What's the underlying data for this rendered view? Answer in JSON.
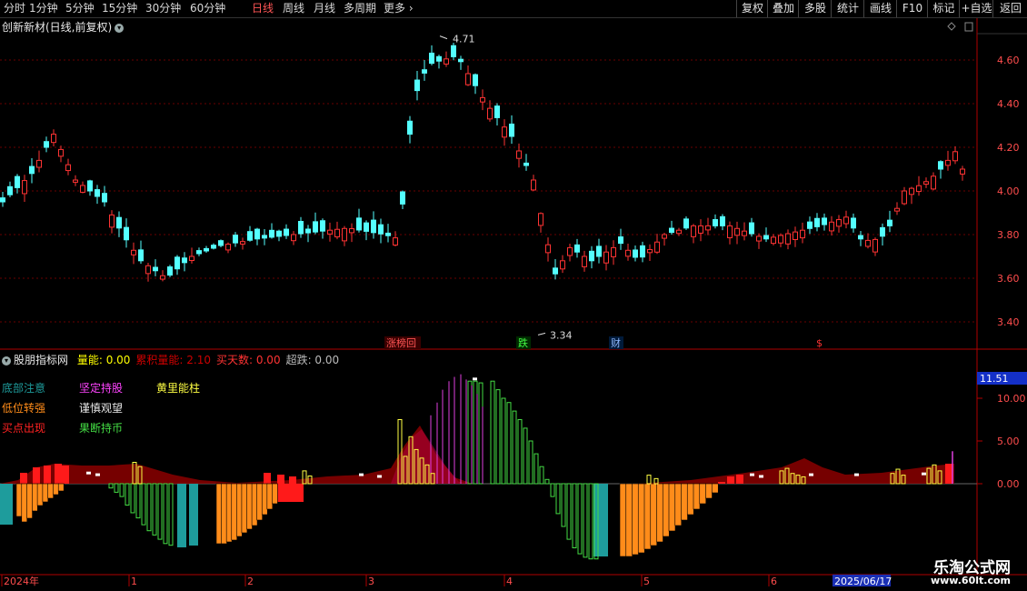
{
  "toolbar": {
    "periods": [
      "分时",
      "1分钟",
      "5分钟",
      "15分钟",
      "30分钟",
      "60分钟",
      "日线",
      "周线",
      "月线",
      "多周期",
      "更多"
    ],
    "active_period": "日线",
    "right_buttons": [
      "复权",
      "叠加",
      "多股",
      "统计",
      "画线",
      "F10",
      "标记",
      "+自选",
      "返回"
    ]
  },
  "price_panel": {
    "stock_title": "创新新材(日线,前复权)",
    "y_ticks": [
      "4.60",
      "4.40",
      "4.20",
      "4.00",
      "3.80",
      "3.60",
      "3.40"
    ],
    "high_label": "4.71",
    "low_label": "3.34",
    "event_labels": [
      "涨榜回",
      "跌",
      "财",
      "$"
    ]
  },
  "indicator_panel": {
    "name": "股朋指标网",
    "fields": [
      {
        "label": "量能:",
        "value": "0.00",
        "color": "#ffff00"
      },
      {
        "label": "累积量能:",
        "value": "2.10",
        "color": "#cc0000"
      },
      {
        "label": "买天数:",
        "value": "0.00",
        "color": "#ff3333"
      },
      {
        "label": "超跌:",
        "value": "0.00",
        "color": "#bbbbbb"
      }
    ],
    "legend": [
      {
        "text": "底部注意",
        "color": "#1e9c9c"
      },
      {
        "text": "坚定持股",
        "color": "#ff44ff"
      },
      {
        "text": "黄里能柱",
        "color": "#ffff44"
      },
      {
        "text": "低位转强",
        "color": "#ff8c1a"
      },
      {
        "text": "谨慎观望",
        "color": "#e8e8e8"
      },
      {
        "text": "买点出现",
        "color": "#ff2222"
      },
      {
        "text": "果断持币",
        "color": "#44dd44"
      }
    ],
    "y_ticks": [
      "10.00",
      "5.00",
      "0.00"
    ],
    "current_value": "11.51"
  },
  "time_axis": {
    "labels": [
      "2024年",
      "1",
      "2",
      "3",
      "4",
      "5",
      "6"
    ],
    "current_date": "2025/06/17"
  },
  "watermark": {
    "name": "乐淘公式网",
    "url": "www.60lt.com"
  }
}
